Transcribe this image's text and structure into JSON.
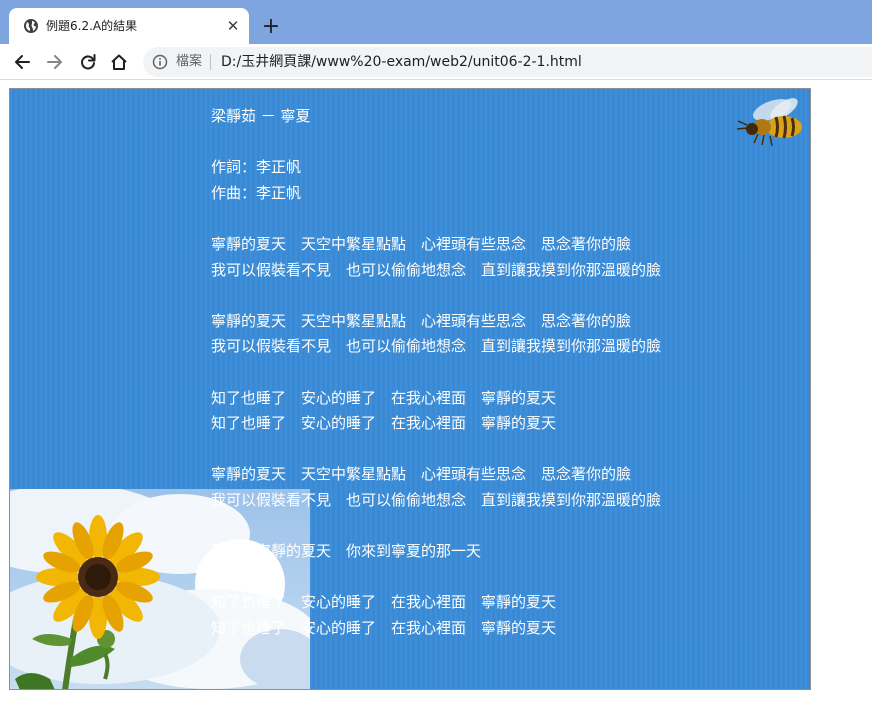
{
  "browser": {
    "tab_title": "例題6.2.A的結果",
    "tab_close_glyph": "✕",
    "new_tab_glyph": "+",
    "security_label": "檔案",
    "url": "D:/玉井網頁課/www%20-exam/web2/unit06-2-1.html",
    "icons": [
      "globe-icon",
      "close-icon",
      "plus-icon",
      "back-arrow-icon",
      "forward-arrow-icon",
      "reload-icon",
      "home-icon",
      "info-icon"
    ],
    "colors": {
      "tabstrip": "#7ea5df",
      "page_background": "#3a8cd8"
    }
  },
  "page": {
    "heading": "梁靜茹 － 寧夏",
    "credits": [
      "作詞：李正帆",
      "作曲：李正帆"
    ],
    "verses": [
      [
        "寧靜的夏天　天空中繁星點點　心裡頭有些思念　思念著你的臉",
        "我可以假裝看不見　也可以偷偷地想念　直到讓我摸到你那溫暖的臉"
      ],
      [
        "寧靜的夏天　天空中繁星點點　心裡頭有些思念　思念著你的臉",
        "我可以假裝看不見　也可以偷偷地想念　直到讓我摸到你那溫暖的臉"
      ],
      [
        "知了也睡了　安心的睡了　在我心裡面　寧靜的夏天",
        "知了也睡了　安心的睡了　在我心裡面　寧靜的夏天"
      ],
      [
        "寧靜的夏天　天空中繁星點點　心裡頭有些思念　思念著你的臉",
        "我可以假裝看不見　也可以偷偷地想念　直到讓我摸到你那溫暖的臉"
      ],
      [
        "那是個寧靜的夏天　你來到寧夏的那一天"
      ],
      [
        "知了也睡了　安心的睡了　在我心裡面　寧靜的夏天",
        "知了也睡了　安心的睡了　在我心裡面　寧靜的夏天"
      ]
    ],
    "images": [
      "bee-image",
      "sunflower-image"
    ]
  }
}
